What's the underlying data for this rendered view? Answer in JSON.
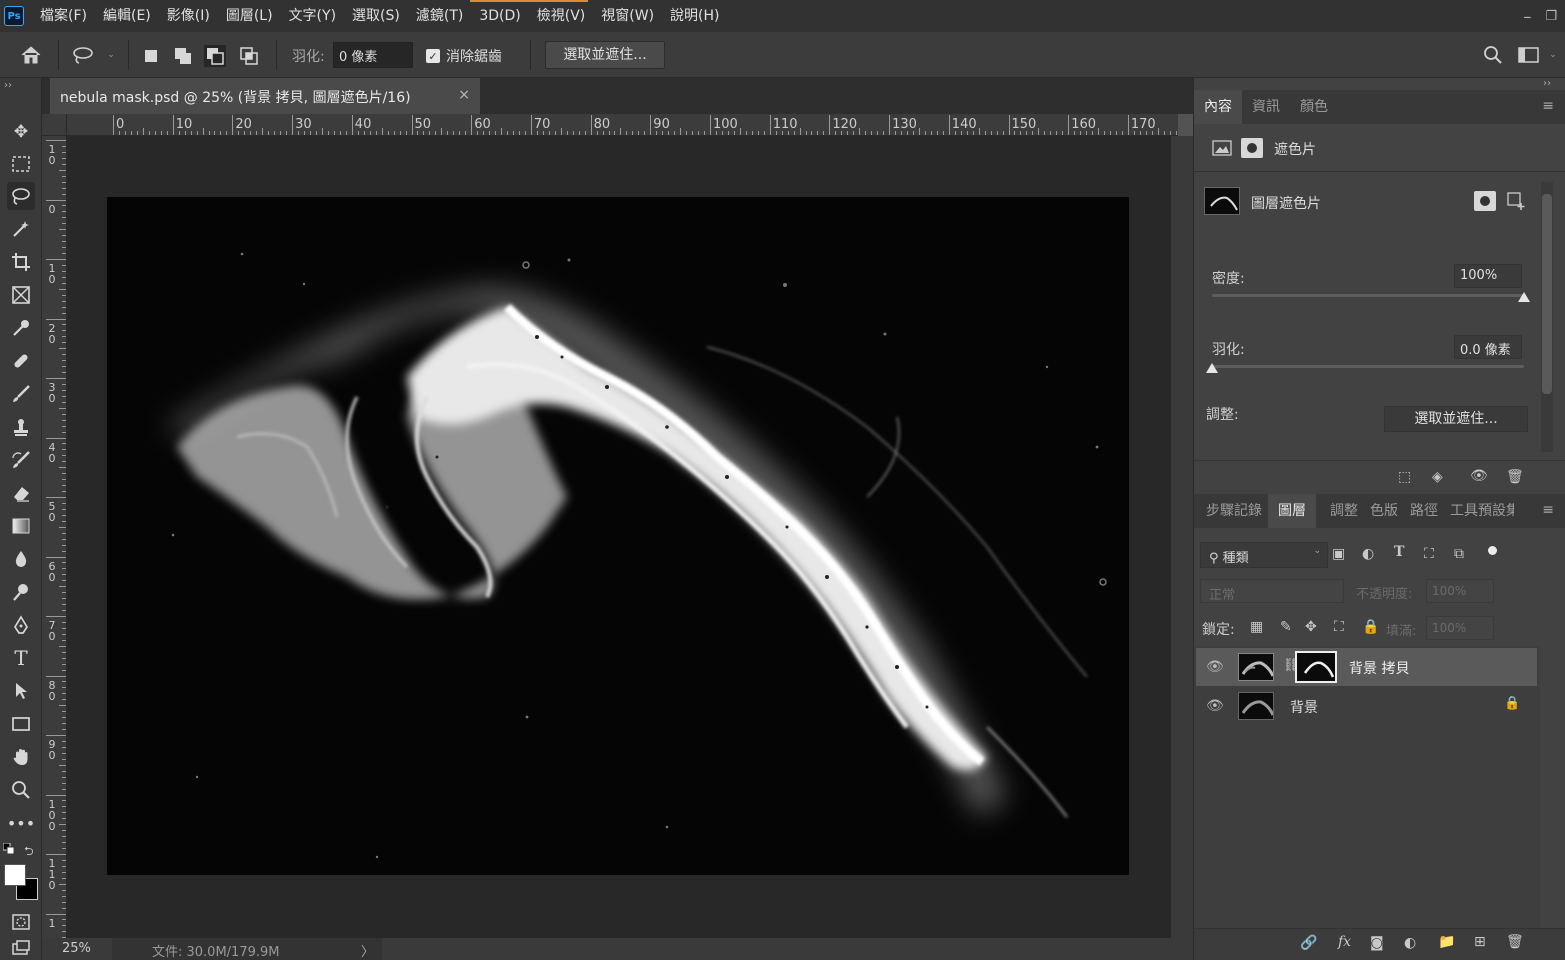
{
  "app": {
    "logo": "Ps"
  },
  "menu": [
    "檔案(F)",
    "編輯(E)",
    "影像(I)",
    "圖層(L)",
    "文字(Y)",
    "選取(S)",
    "濾鏡(T)",
    "3D(D)",
    "檢視(V)",
    "視窗(W)",
    "說明(H)"
  ],
  "options": {
    "feather_label": "羽化:",
    "feather_value": "0 像素",
    "antialias_label": "消除鋸齒",
    "antialias_checked": true,
    "select_mask_label": "選取並遮住..."
  },
  "document": {
    "tab_title": "nebula mask.psd @ 25% (背景 拷貝, 圖層遮色片/16)",
    "close_glyph": "×",
    "ruler_h": [
      "0",
      "10",
      "20",
      "30",
      "40",
      "50",
      "60",
      "70",
      "80",
      "90",
      "100",
      "110",
      "120",
      "130",
      "140",
      "150",
      "160",
      "170"
    ],
    "ruler_v": [
      "1\n0",
      "0",
      "1\n0",
      "2\n0",
      "3\n0",
      "4\n0",
      "5\n0",
      "6\n0",
      "7\n0",
      "8\n0",
      "9\n0",
      "1\n0\n0",
      "1\n1\n0",
      "1"
    ],
    "zoom": "25%",
    "file_info": "文件: 30.0M/179.9M",
    "file_info_chevron": "〉"
  },
  "properties": {
    "tabs": [
      "內容",
      "資訊",
      "顏色"
    ],
    "active_tab": 0,
    "mask_section_label": "遮色片",
    "layer_mask_label": "圖層遮色片",
    "density_label": "密度:",
    "density_value": "100%",
    "density_fraction": 1.0,
    "feather_label": "羽化:",
    "feather_value": "0.0 像素",
    "feather_fraction": 0.0,
    "refine_label": "調整:",
    "refine_button": "選取並遮住..."
  },
  "layers_panel": {
    "tabs": [
      "步驟記錄",
      "圖層",
      "調整",
      "色版",
      "路徑",
      "工具預設集"
    ],
    "active_tab": 1,
    "filter_label": "種類",
    "blend_mode": "正常",
    "opacity_label": "不透明度:",
    "opacity_value": "100%",
    "lock_label": "鎖定:",
    "fill_label": "填滿:",
    "fill_value": "100%",
    "layers": [
      {
        "name": "背景 拷貝",
        "selected": true,
        "has_mask": true,
        "locked": false
      },
      {
        "name": "背景",
        "selected": false,
        "has_mask": false,
        "locked": true
      }
    ],
    "footer_fx": "fx"
  },
  "colors": {
    "accent": "#31a8ff",
    "menubar_accent": "#d98b3a",
    "foreground": "#ffffff",
    "background": "#000000"
  }
}
